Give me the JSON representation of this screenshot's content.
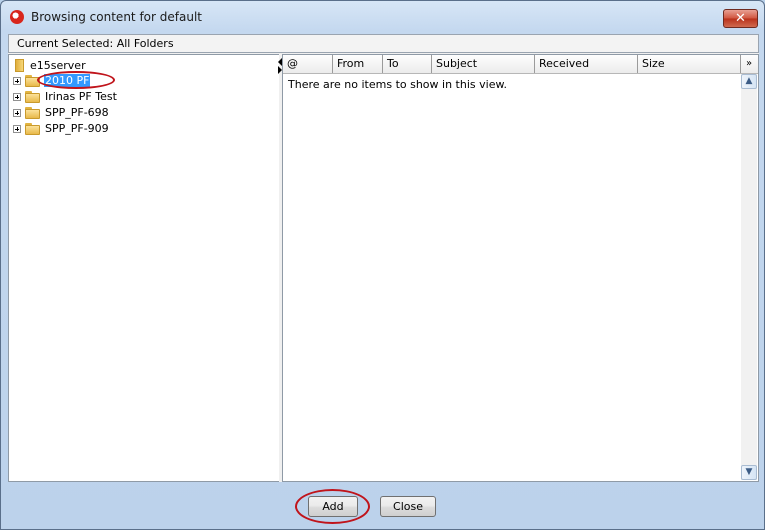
{
  "window": {
    "title": "Browsing content for default",
    "close_glyph": "✕"
  },
  "current_selected": "Current Selected: All Folders",
  "tree": {
    "root": "e15server",
    "items": [
      {
        "label": "2010 PF",
        "selected": true
      },
      {
        "label": "Irinas PF Test",
        "selected": false
      },
      {
        "label": "SPP_PF-698",
        "selected": false
      },
      {
        "label": "SPP_PF-909",
        "selected": false
      }
    ]
  },
  "list": {
    "columns": [
      {
        "label": "@",
        "icon": "attachment-icon"
      },
      {
        "label": "From"
      },
      {
        "label": "To"
      },
      {
        "label": "Subject"
      },
      {
        "label": "Received"
      },
      {
        "label": "Size"
      }
    ],
    "empty_message": "There are no items to show in this view.",
    "overflow_glyph": "»"
  },
  "scroll": {
    "up_glyph": "▲",
    "down_glyph": "▼"
  },
  "buttons": {
    "add": "Add",
    "close": "Close"
  },
  "colors": {
    "selection": "#3399ff",
    "annotation_ring": "#c0141b"
  }
}
